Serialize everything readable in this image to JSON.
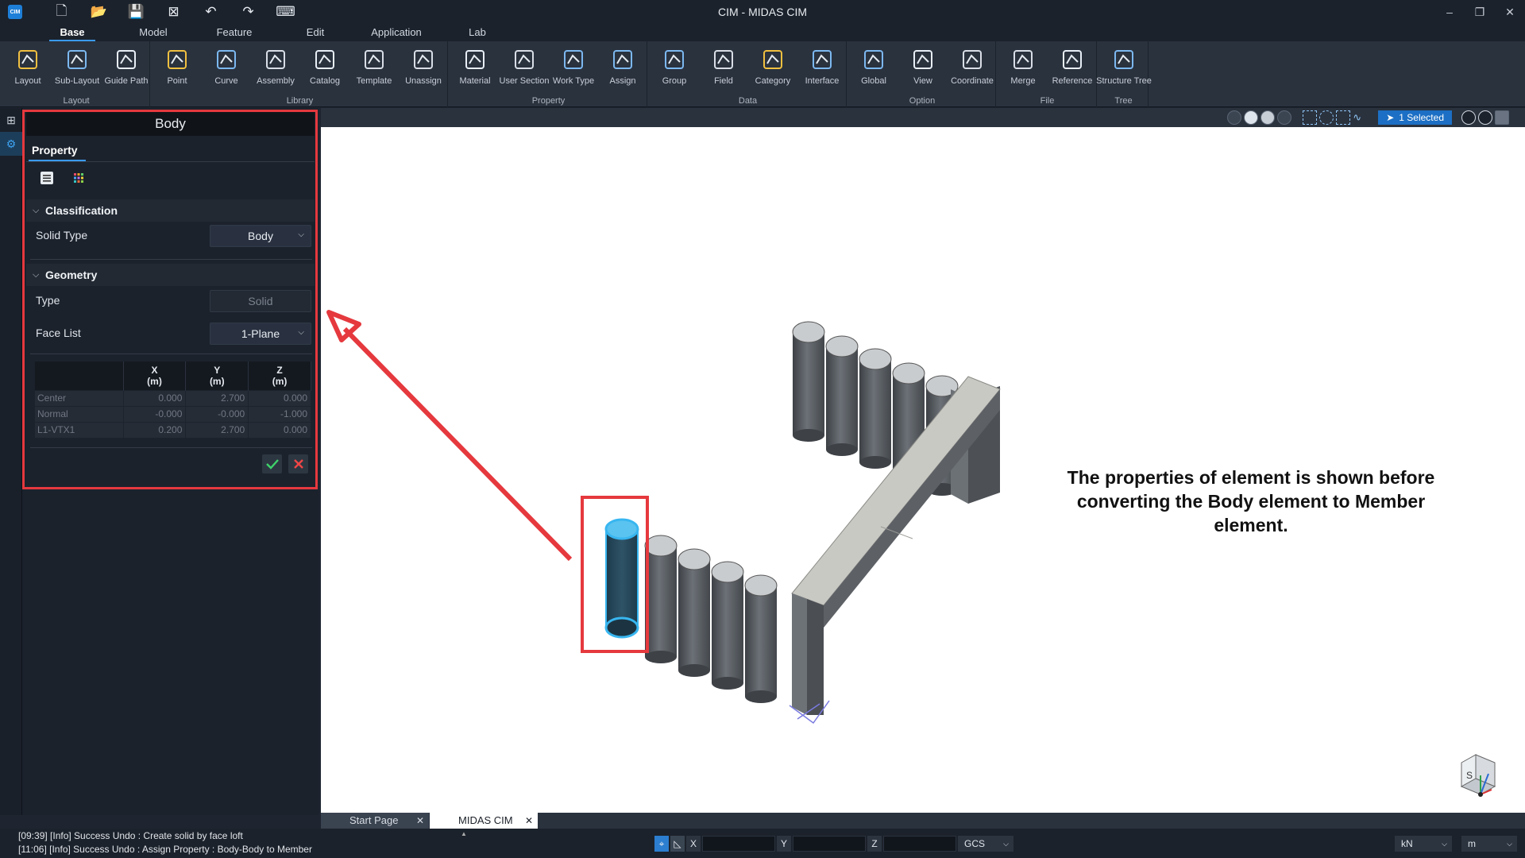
{
  "app": {
    "title": "CIM - MIDAS CIM",
    "logo_text": "CIM"
  },
  "quick_access": [
    {
      "name": "new-file-icon",
      "glyph": "🗋"
    },
    {
      "name": "open-folder-icon",
      "glyph": "📂"
    },
    {
      "name": "save-icon",
      "glyph": "💾"
    },
    {
      "name": "close-file-icon",
      "glyph": "⊠"
    },
    {
      "name": "undo-icon",
      "glyph": "↶"
    },
    {
      "name": "redo-icon",
      "glyph": "↷"
    },
    {
      "name": "keyboard-icon",
      "glyph": "⌨"
    }
  ],
  "window_controls": [
    {
      "name": "minimize-icon",
      "glyph": "–"
    },
    {
      "name": "restore-icon",
      "glyph": "❐"
    },
    {
      "name": "close-window-icon",
      "glyph": "✕"
    }
  ],
  "menu_tabs": [
    "Base",
    "Model",
    "Feature",
    "Edit",
    "Application",
    "Lab"
  ],
  "ribbon": {
    "groups": [
      {
        "label": "Layout",
        "buttons": [
          "Layout",
          "Sub-Layout",
          "Guide Path"
        ]
      },
      {
        "label": "Library",
        "buttons": [
          "Point",
          "Curve",
          "Assembly",
          "Catalog",
          "Template",
          "Unassign"
        ]
      },
      {
        "label": "Property",
        "buttons": [
          "Material",
          "User Section",
          "Work Type",
          "Assign"
        ]
      },
      {
        "label": "Data",
        "buttons": [
          "Group",
          "Field",
          "Category",
          "Interface"
        ]
      },
      {
        "label": "Option",
        "buttons": [
          "Global",
          "View",
          "Coordinate"
        ]
      },
      {
        "label": "File",
        "buttons": [
          "Merge",
          "Reference"
        ]
      },
      {
        "label": "Tree",
        "buttons": [
          "Structure Tree"
        ]
      }
    ]
  },
  "viewport_toolbar": {
    "selection_badge": "1 Selected"
  },
  "panel": {
    "title": "Body",
    "tab": "Property",
    "classification": {
      "header": "Classification",
      "solid_type_label": "Solid Type",
      "solid_type_value": "Body"
    },
    "geometry": {
      "header": "Geometry",
      "type_label": "Type",
      "type_value": "Solid",
      "face_list_label": "Face List",
      "face_list_value": "1-Plane"
    },
    "table": {
      "headers": [
        " ",
        "X\n(m)",
        "Y\n(m)",
        "Z\n(m)"
      ],
      "rows": [
        [
          "Center",
          "0.000",
          "2.700",
          "0.000"
        ],
        [
          "Normal",
          "-0.000",
          "-0.000",
          "-1.000"
        ],
        [
          "L1-VTX1",
          "0.200",
          "2.700",
          "0.000"
        ]
      ]
    }
  },
  "annotation": {
    "text": "The properties of element is shown before converting the Body element to Member element."
  },
  "doc_tabs": [
    "Start Page",
    "MIDAS CIM"
  ],
  "log": [
    "[09:39] [Info] Success Undo : Create solid by face loft",
    "[11:06] [Info] Success Undo : Assign Property : Body-Body to Member"
  ],
  "coords": {
    "x_label": "X",
    "y_label": "Y",
    "z_label": "Z",
    "system": "GCS"
  },
  "units": {
    "force": "kN",
    "length": "m"
  },
  "colors": {
    "accent": "#3a9af0",
    "highlight": "#e5393e",
    "selected": "#38b6f0"
  }
}
